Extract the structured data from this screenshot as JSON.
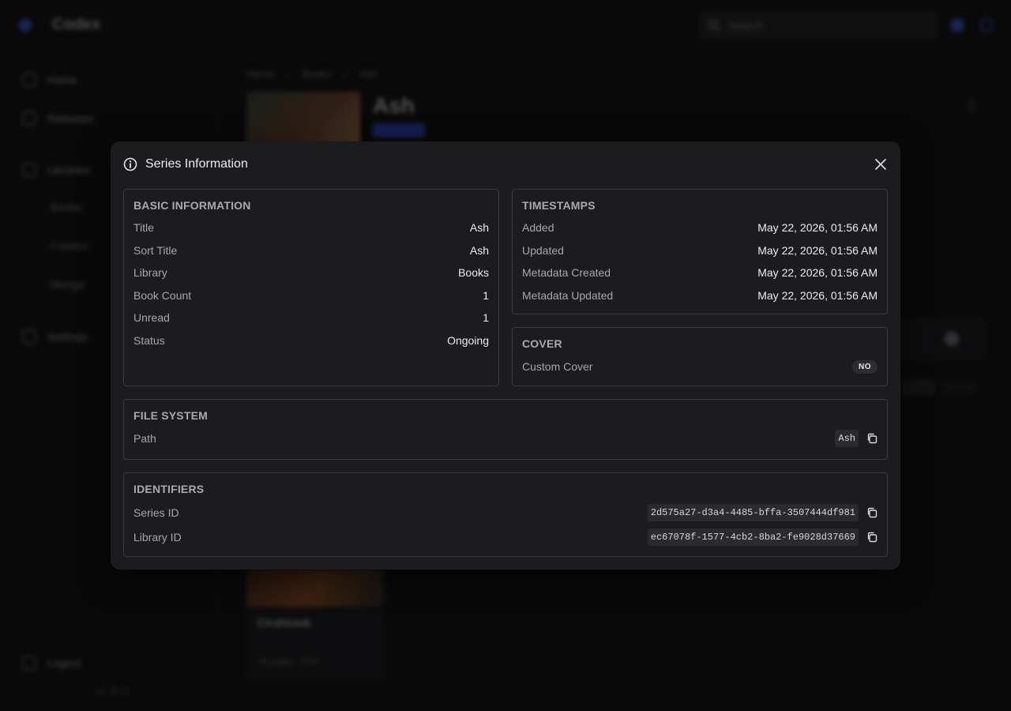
{
  "app": {
    "name": "Codex",
    "search_placeholder": "Search",
    "nav": [
      {
        "label": "Home"
      },
      {
        "label": "Releases"
      },
      {
        "label": "Libraries"
      }
    ],
    "nav_sub": [
      "Books",
      "Comics",
      "Manga"
    ],
    "settings_label": "Settings",
    "logout_label": "Logout",
    "version": "v1.35.0",
    "breadcrumb": [
      "Home",
      "Books",
      "Ash"
    ],
    "series_title": "Ash",
    "book": {
      "title": "Cirahtuwk",
      "meta": "76 pages · PDF"
    }
  },
  "modal": {
    "title": "Series Information",
    "basic": {
      "heading": "BASIC INFORMATION",
      "rows": [
        {
          "label": "Title",
          "value": "Ash"
        },
        {
          "label": "Sort Title",
          "value": "Ash"
        },
        {
          "label": "Library",
          "value": "Books"
        },
        {
          "label": "Book Count",
          "value": "1"
        },
        {
          "label": "Unread",
          "value": "1"
        },
        {
          "label": "Status",
          "value": "Ongoing"
        }
      ]
    },
    "timestamps": {
      "heading": "TIMESTAMPS",
      "rows": [
        {
          "label": "Added",
          "value": "May 22, 2026, 01:56 AM"
        },
        {
          "label": "Updated",
          "value": "May 22, 2026, 01:56 AM"
        },
        {
          "label": "Metadata Created",
          "value": "May 22, 2026, 01:56 AM"
        },
        {
          "label": "Metadata Updated",
          "value": "May 22, 2026, 01:56 AM"
        }
      ]
    },
    "cover": {
      "heading": "COVER",
      "custom_cover_label": "Custom Cover",
      "custom_cover_value": "NO"
    },
    "file_system": {
      "heading": "FILE SYSTEM",
      "path_label": "Path",
      "path_value": "Ash"
    },
    "identifiers": {
      "heading": "IDENTIFIERS",
      "series_id_label": "Series ID",
      "series_id_value": "2d575a27-d3a4-4485-bffa-3507444df981",
      "library_id_label": "Library ID",
      "library_id_value": "ec67078f-1577-4cb2-8ba2-fe9028d37669"
    }
  },
  "colors": {
    "accent": "#3b5bdb",
    "modal_bg": "#1c1c1f",
    "border": "#3a3a40"
  }
}
